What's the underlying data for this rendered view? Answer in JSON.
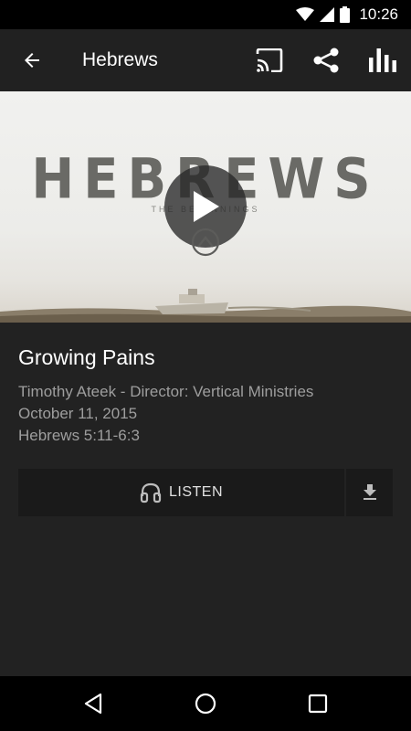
{
  "status_bar": {
    "time": "10:26",
    "icons": [
      "wifi-icon",
      "signal-icon",
      "battery-icon"
    ]
  },
  "app_bar": {
    "title": "Hebrews",
    "back_icon": "arrow-back-icon",
    "actions": [
      "cast-icon",
      "share-icon",
      "stats-icon"
    ]
  },
  "hero": {
    "series_title": "HEBREWS",
    "series_subtitle": "THE BEGINNINGS",
    "play_icon": "play-icon"
  },
  "sermon": {
    "title": "Growing Pains",
    "speaker": "Timothy Ateek - Director: Vertical Ministries",
    "date": "October 11, 2015",
    "passage": "Hebrews 5:11-6:3"
  },
  "actions": {
    "listen_label": "LISTEN",
    "listen_icon": "headphones-icon",
    "download_icon": "download-icon"
  },
  "nav_bar": {
    "buttons": [
      "back-triangle-icon",
      "home-circle-icon",
      "recents-square-icon"
    ]
  },
  "colors": {
    "background": "#222222",
    "app_bar": "#212121",
    "status_bar": "#000000",
    "button_bg": "#1a1a1a",
    "meta_text": "#9e9e9e"
  }
}
